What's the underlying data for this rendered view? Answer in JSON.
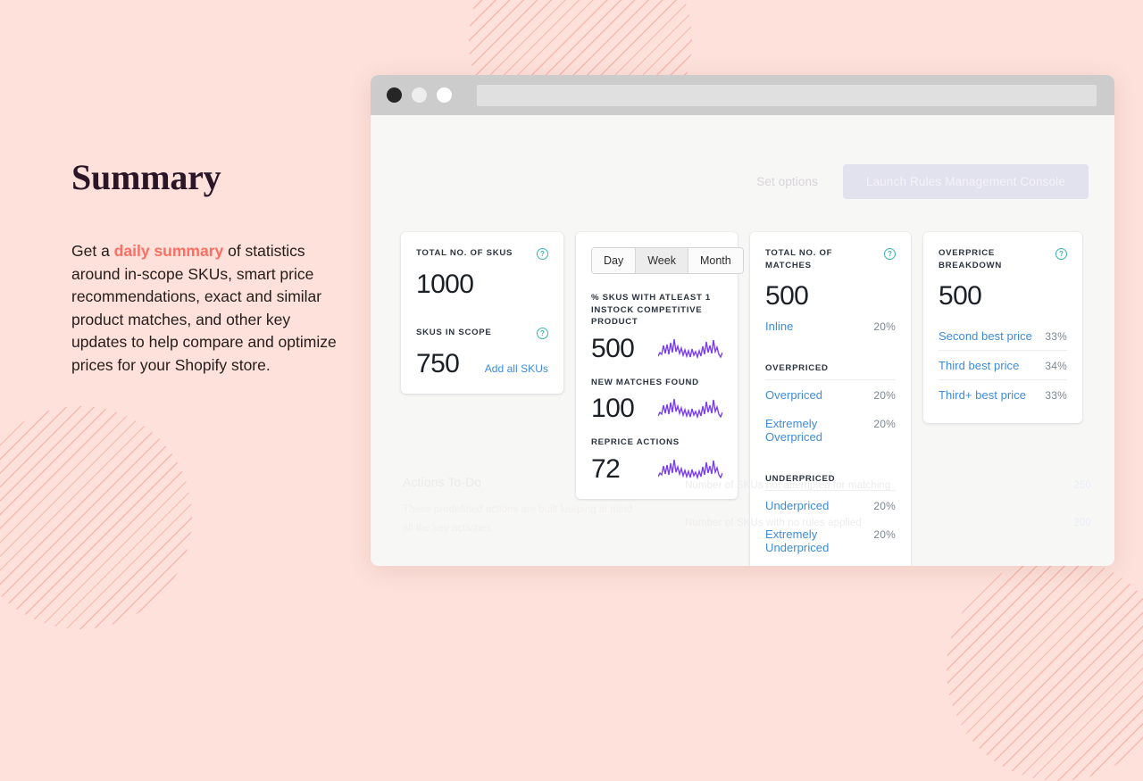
{
  "left": {
    "title": "Summary",
    "body_before": "Get a ",
    "body_highlight": "daily summary",
    "body_after": " of statistics around in-scope SKUs, smart price recommendations, exact and similar product matches, and other key updates to help compare and optimize prices for your Shopify store."
  },
  "browser": {
    "address_value": "",
    "dots": [
      "close-dot",
      "minimize-dot",
      "maximize-dot"
    ]
  },
  "toolbar": {
    "set_options_label": "Set options",
    "launch_label": "Launch Rules Management Console"
  },
  "cards": {
    "skus": {
      "total_label": "TOTAL NO. OF SKUS",
      "total_value": "1000",
      "scope_label": "SKUS IN SCOPE",
      "scope_value": "750",
      "add_all_label": "Add all SKUs",
      "help_icon": "help-icon"
    },
    "activity": {
      "tabs": [
        {
          "label": "Day",
          "active": false
        },
        {
          "label": "Week",
          "active": true
        },
        {
          "label": "Month",
          "active": false
        }
      ],
      "metrics": [
        {
          "label": "% SKUS WITH ATLEAST 1 INSTOCK COMPETITIVE PRODUCT",
          "value": "500"
        },
        {
          "label": "NEW MATCHES FOUND",
          "value": "100"
        },
        {
          "label": "REPRICE ACTIONS",
          "value": "72"
        }
      ]
    },
    "matches": {
      "label": "TOTAL NO. OF MATCHES",
      "value": "500",
      "inline": {
        "label": "Inline",
        "pct": "20%"
      },
      "overpriced_title": "OVERPRICED",
      "overpriced": [
        {
          "label": "Overpriced",
          "pct": "20%"
        },
        {
          "label": "Extremely Overpriced",
          "pct": "20%"
        }
      ],
      "underpriced_title": "UNDERPRICED",
      "underpriced": [
        {
          "label": "Underpriced",
          "pct": "20%"
        },
        {
          "label": "Extremely Underpriced",
          "pct": "20%"
        }
      ]
    },
    "overprice": {
      "label": "OVERPRICE BREAKDOWN",
      "value": "500",
      "rows": [
        {
          "label": "Second best price",
          "pct": "33%"
        },
        {
          "label": "Third best price",
          "pct": "34%"
        },
        {
          "label": "Third+ best price",
          "pct": "33%"
        }
      ]
    }
  },
  "bottom": {
    "title": "Actions To-Do",
    "subtitle": "These predefined actions are built keeping in mind all the key activities",
    "rows": [
      {
        "label": "Number of SKUs not attempted for matching",
        "value": "250"
      },
      {
        "label": "Number of SKUs with no rules applied",
        "value": "200"
      }
    ]
  },
  "colors": {
    "page_bg": "#fde1da",
    "accent_coral": "#fb6f63",
    "link_blue": "#3d8bdb",
    "help_teal": "#3bb3b0",
    "spark_purple": "#7b3fe4",
    "title_plum": "#2b1627"
  }
}
